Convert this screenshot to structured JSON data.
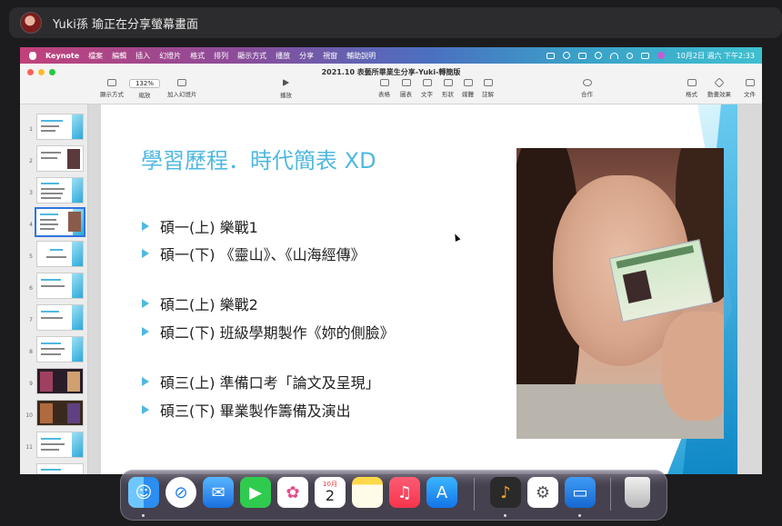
{
  "share": {
    "text": "Yuki孫 瑜正在分享螢幕畫面"
  },
  "menubar": {
    "app": "Keynote",
    "items": [
      "檔案",
      "編輯",
      "插入",
      "幻燈片",
      "格式",
      "排列",
      "顯示方式",
      "播放",
      "分享",
      "視窗",
      "輔助說明"
    ],
    "clock": "10月2日 週六 下午2:33"
  },
  "window": {
    "title": "2021.10 表藝所畢業生分享-Yuki-轉簡版",
    "toolbar": {
      "view": "顯示方式",
      "zoom_value": "132%",
      "zoom": "縮放",
      "add_slide": "加入幻燈片",
      "play": "播放",
      "table": "表格",
      "chart": "圖表",
      "text": "文字",
      "shape": "形狀",
      "media": "媒體",
      "comment": "註解",
      "collaborate": "合作",
      "format": "格式",
      "animate": "動畫效果",
      "document": "文件"
    }
  },
  "sidebar": {
    "slides": [
      "1",
      "2",
      "3",
      "4",
      "5",
      "6",
      "7",
      "8",
      "9",
      "10",
      "11"
    ],
    "selected": "4"
  },
  "slide": {
    "title": "學習歷程．時代簡表 XD",
    "bullets": [
      "碩一(上)  樂戰1",
      "碩一(下)  《靈山》、《山海經傳》",
      "碩二(上)  樂戰2",
      "碩二(下)  班級學期製作《妳的側臉》",
      "碩三(上)  準備口考「論文及呈現」",
      "碩三(下)  畢業製作籌備及演出"
    ]
  },
  "dock": {
    "calendar_month": "10月",
    "calendar_day": "2",
    "apps": [
      "finder-icon",
      "safari-icon",
      "mail-icon",
      "facetime-icon",
      "photos-icon",
      "calendar-icon",
      "notes-icon",
      "music-icon",
      "app-store-icon",
      "garageband-icon",
      "hardware-util-icon",
      "keynote-icon",
      "trash-icon"
    ]
  },
  "colors": {
    "accent": "#4fb8e0",
    "selection": "#2f74e0"
  }
}
